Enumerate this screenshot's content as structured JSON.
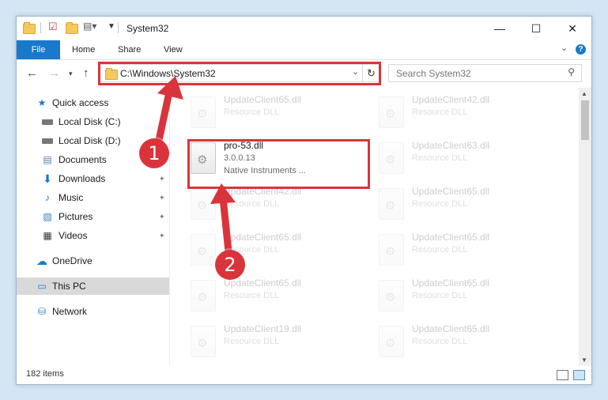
{
  "window": {
    "title": "System32",
    "controls": {
      "minimize": "—",
      "maximize": "☐",
      "close": "✕"
    }
  },
  "ribbon": {
    "tabs": [
      "File",
      "Home",
      "Share",
      "View"
    ],
    "expand_icon": "chevron-down-icon",
    "help": "?"
  },
  "address_bar": {
    "path": "C:\\Windows\\System32",
    "refresh_icon": "↻"
  },
  "search": {
    "placeholder": "Search System32"
  },
  "sidebar": {
    "items": [
      {
        "label": "Quick access",
        "icon": "star-icon",
        "pinned": false
      },
      {
        "label": "Local Disk (C:)",
        "icon": "drive-icon",
        "pinned": false
      },
      {
        "label": "Local Disk (D:)",
        "icon": "drive-icon",
        "pinned": false
      },
      {
        "label": "Documents",
        "icon": "document-icon",
        "pinned": true
      },
      {
        "label": "Downloads",
        "icon": "download-icon",
        "pinned": true
      },
      {
        "label": "Music",
        "icon": "music-icon",
        "pinned": true
      },
      {
        "label": "Pictures",
        "icon": "picture-icon",
        "pinned": true
      },
      {
        "label": "Videos",
        "icon": "video-icon",
        "pinned": true
      },
      {
        "label": "OneDrive",
        "icon": "cloud-icon",
        "pinned": false
      },
      {
        "label": "This PC",
        "icon": "computer-icon",
        "pinned": false,
        "selected": true
      },
      {
        "label": "Network",
        "icon": "network-icon",
        "pinned": false
      }
    ]
  },
  "files": [
    {
      "name": "UpdateClient65.dll",
      "type": "Resource DLL",
      "faded": true
    },
    {
      "name": "UpdateClient42.dll",
      "type": "Resource DLL",
      "faded": true
    },
    {
      "name": "pro-53.dll",
      "version": "3.0.0.13",
      "company": "Native Instruments ...",
      "faded": false
    },
    {
      "name": "UpdateClient63.dll",
      "type": "Resource DLL",
      "faded": true
    },
    {
      "name": "UpdateClient42.dll",
      "type": "Resource DLL",
      "faded": true
    },
    {
      "name": "UpdateClient65.dll",
      "type": "Resource DLL",
      "faded": true
    },
    {
      "name": "UpdateClient65.dll",
      "type": "Resource DLL",
      "faded": true
    },
    {
      "name": "UpdateClient65.dll",
      "type": "Resource DLL",
      "faded": true
    },
    {
      "name": "UpdateClient65.dll",
      "type": "Resource DLL",
      "faded": true
    },
    {
      "name": "UpdateClient65.dll",
      "type": "Resource DLL",
      "faded": true
    },
    {
      "name": "UpdateClient19.dll",
      "type": "Resource DLL",
      "faded": true
    },
    {
      "name": "UpdateClient65.dll",
      "type": "Resource DLL",
      "faded": true
    }
  ],
  "status": {
    "item_count": "182 items"
  },
  "annotations": {
    "callout_1": "1",
    "callout_2": "2",
    "highlight_color": "#d9343b"
  },
  "colors": {
    "accent": "#1979ca",
    "selected_bg": "#d9d9d9"
  }
}
